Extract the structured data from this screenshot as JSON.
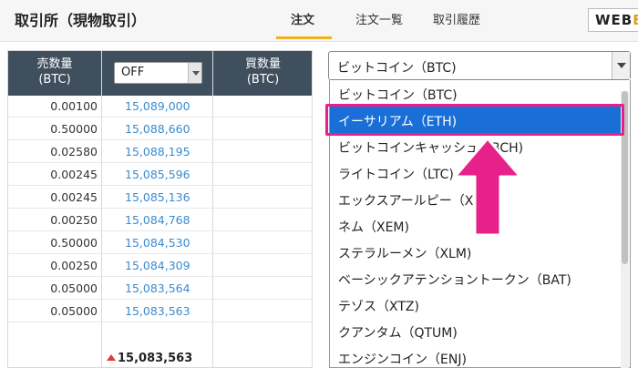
{
  "header": {
    "title": "取引所（現物取引）",
    "tabs": [
      {
        "label": "注文",
        "active": true
      },
      {
        "label": "注文一覧",
        "active": false
      },
      {
        "label": "取引履歴",
        "active": false
      }
    ],
    "badge_text": "WEB",
    "badge_last": "B"
  },
  "order_book": {
    "sell_header_line1": "売数量",
    "sell_header_line2": "(BTC)",
    "buy_header_line1": "買数量",
    "buy_header_line2": "(BTC)",
    "filter_select_value": "OFF",
    "rows": [
      {
        "qty": "0.00100",
        "price": "15,089,000"
      },
      {
        "qty": "0.50000",
        "price": "15,088,660"
      },
      {
        "qty": "0.02580",
        "price": "15,088,195"
      },
      {
        "qty": "0.00245",
        "price": "15,085,596"
      },
      {
        "qty": "0.00245",
        "price": "15,085,136"
      },
      {
        "qty": "0.00250",
        "price": "15,084,768"
      },
      {
        "qty": "0.50000",
        "price": "15,084,530"
      },
      {
        "qty": "0.00250",
        "price": "15,084,309"
      },
      {
        "qty": "0.05000",
        "price": "15,083,564"
      },
      {
        "qty": "0.05000",
        "price": "15,083,563"
      }
    ],
    "last_price": "15,083,563"
  },
  "coin_select": {
    "value": "ビットコイン（BTC)",
    "options": [
      "ビットコイン（BTC)",
      "イーサリアム（ETH)",
      "ビットコインキャッシュ（BCH)",
      "ライトコイン（LTC)",
      "エックスアールピー（XRP)",
      "ネム（XEM)",
      "ステラルーメン（XLM)",
      "ベーシックアテンショントークン（BAT)",
      "テゾス（XTZ)",
      "クアンタム（QTUM)",
      "エンジンコイン（ENJ)"
    ],
    "selected_index": 1
  },
  "colors": {
    "header_dark": "#3f4f5e",
    "price_blue": "#3b8bd0",
    "selected_blue": "#1a6fd6",
    "annotation_pink": "#e8208a",
    "tab_underline": "#f0b01f",
    "up_red": "#e23c2e"
  }
}
